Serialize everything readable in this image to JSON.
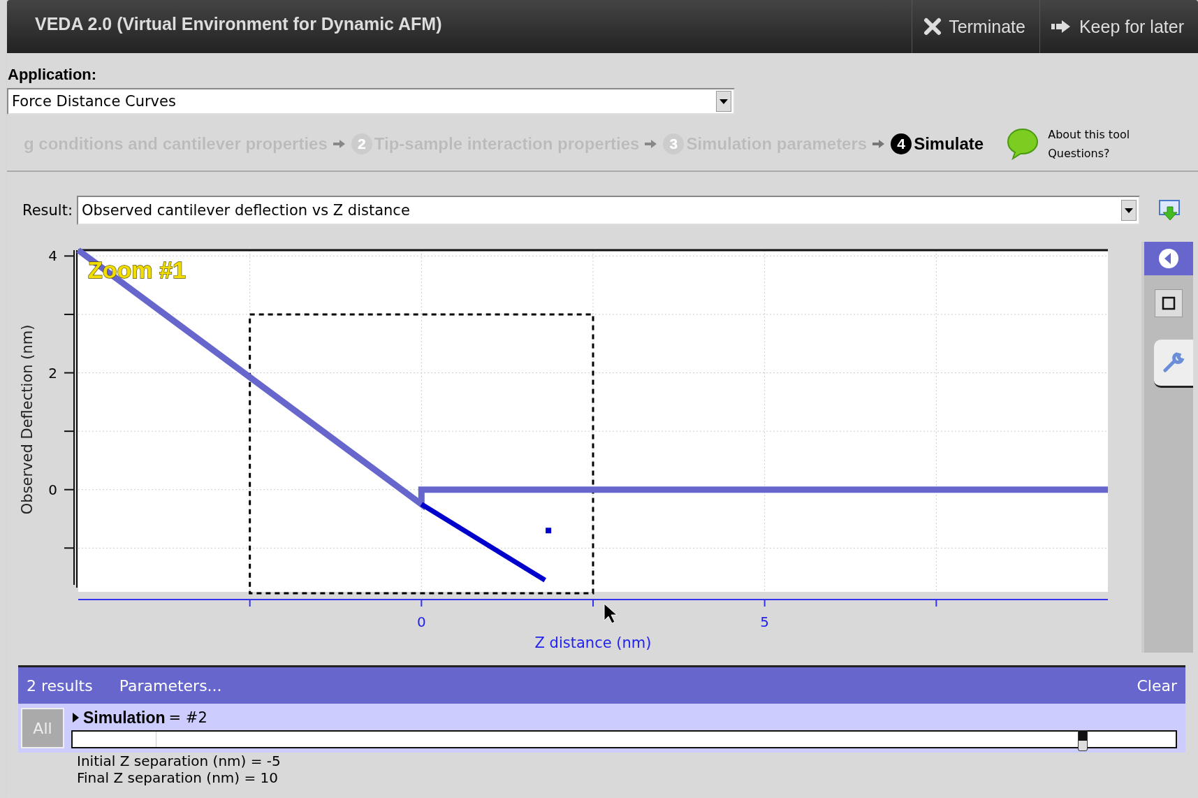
{
  "window": {
    "title": "VEDA 2.0 (Virtual Environment for Dynamic AFM)",
    "actions": [
      {
        "kind": "close",
        "label": "Terminate"
      },
      {
        "kind": "forward",
        "label": "Keep for later"
      }
    ]
  },
  "application": {
    "label": "Application:",
    "value": "Force Distance Curves"
  },
  "steps": [
    {
      "label": "g conditions and cantilever properties",
      "selected": false
    },
    {
      "number": "2",
      "label": "Tip-sample interaction properties",
      "selected": false
    },
    {
      "number": "3",
      "label": "Simulation parameters",
      "selected": false
    },
    {
      "number": "4",
      "label": "Simulate",
      "selected": true
    }
  ],
  "help": {
    "about": "About this tool",
    "questions": "Questions?"
  },
  "result": {
    "label": "Result:",
    "value": "Observed cantilever deflection vs Z distance"
  },
  "chart_data": {
    "type": "line",
    "grid": true,
    "xlabel": "Z distance (nm)",
    "ylabel": "Observed Deflection (nm)",
    "xlim": [
      -5,
      10
    ],
    "ylim": [
      -1.75,
      4.1
    ],
    "xticks": [
      0,
      5
    ],
    "yticks": [
      0,
      2,
      4
    ],
    "annotations": [
      "Zoom #1"
    ],
    "series": [
      {
        "color": "#6666cc",
        "x": [
          -5,
          0,
          0,
          10
        ],
        "values": [
          4.1,
          -0.25,
          0,
          0
        ]
      },
      {
        "color": "#0000cc",
        "x": [
          0,
          1.8
        ],
        "values": [
          -0.25,
          -1.55
        ]
      },
      {
        "color": "#0000cc",
        "marker": "square",
        "x": [
          1.85
        ],
        "values": [
          -0.7
        ]
      }
    ]
  },
  "results_bar": {
    "count": "2 results",
    "parameters": "Parameters...",
    "clear": "Clear"
  },
  "simulation": {
    "all": "All",
    "name": "Simulation",
    "value": "= #2",
    "expanded": false,
    "level": 0.916
  },
  "parameters": [
    "Initial Z separation (nm) = -5",
    "Final Z separation (nm) = 10"
  ]
}
